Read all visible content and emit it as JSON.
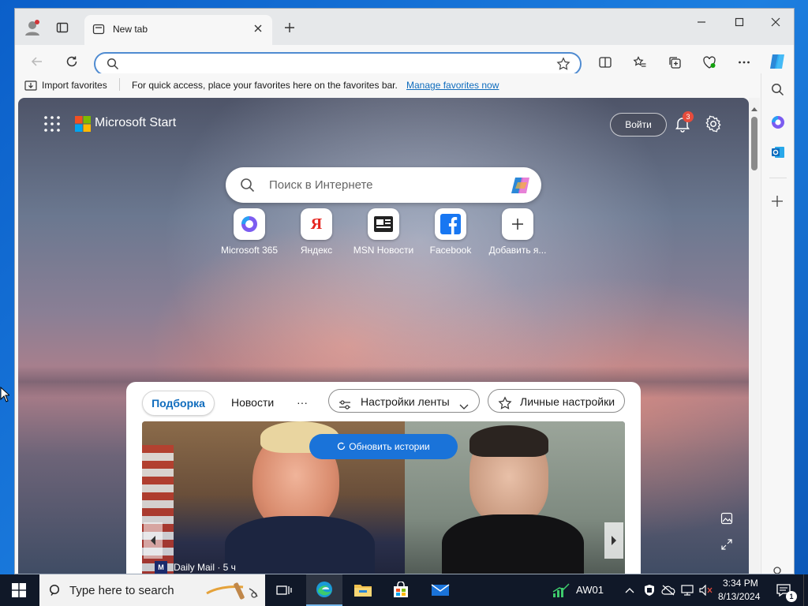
{
  "browser": {
    "tab_title": "New tab",
    "address_placeholder": "",
    "favorites_bar": {
      "import_label": "Import favorites",
      "hint_text": "For quick access, place your favorites here on the favorites bar.",
      "manage_link": "Manage favorites now"
    }
  },
  "start_page": {
    "brand": "Microsoft Start",
    "signin_label": "Войти",
    "notification_count": "3",
    "search_placeholder": "Поиск в Интернете",
    "quick_links": [
      {
        "label": "Microsoft 365"
      },
      {
        "label": "Яндекс"
      },
      {
        "label": "MSN Новости"
      },
      {
        "label": "Facebook"
      },
      {
        "label": "Добавить я..."
      }
    ],
    "feed": {
      "tabs": [
        "Подборка",
        "Новости",
        "···"
      ],
      "feed_settings_label": "Настройки ленты",
      "personal_settings_label": "Личные настройки",
      "refresh_label": "Обновить истории",
      "story_source": "Daily Mail · 5 ч"
    }
  },
  "taskbar": {
    "search_placeholder": "Type here to search",
    "stock_label": "AW01",
    "time": "3:34 PM",
    "date": "8/13/2024",
    "notification_badge": "1"
  },
  "colors": {
    "accent": "#0f6cbd",
    "refresh_button": "#1a73d9",
    "address_border": "#4f8bd1"
  }
}
